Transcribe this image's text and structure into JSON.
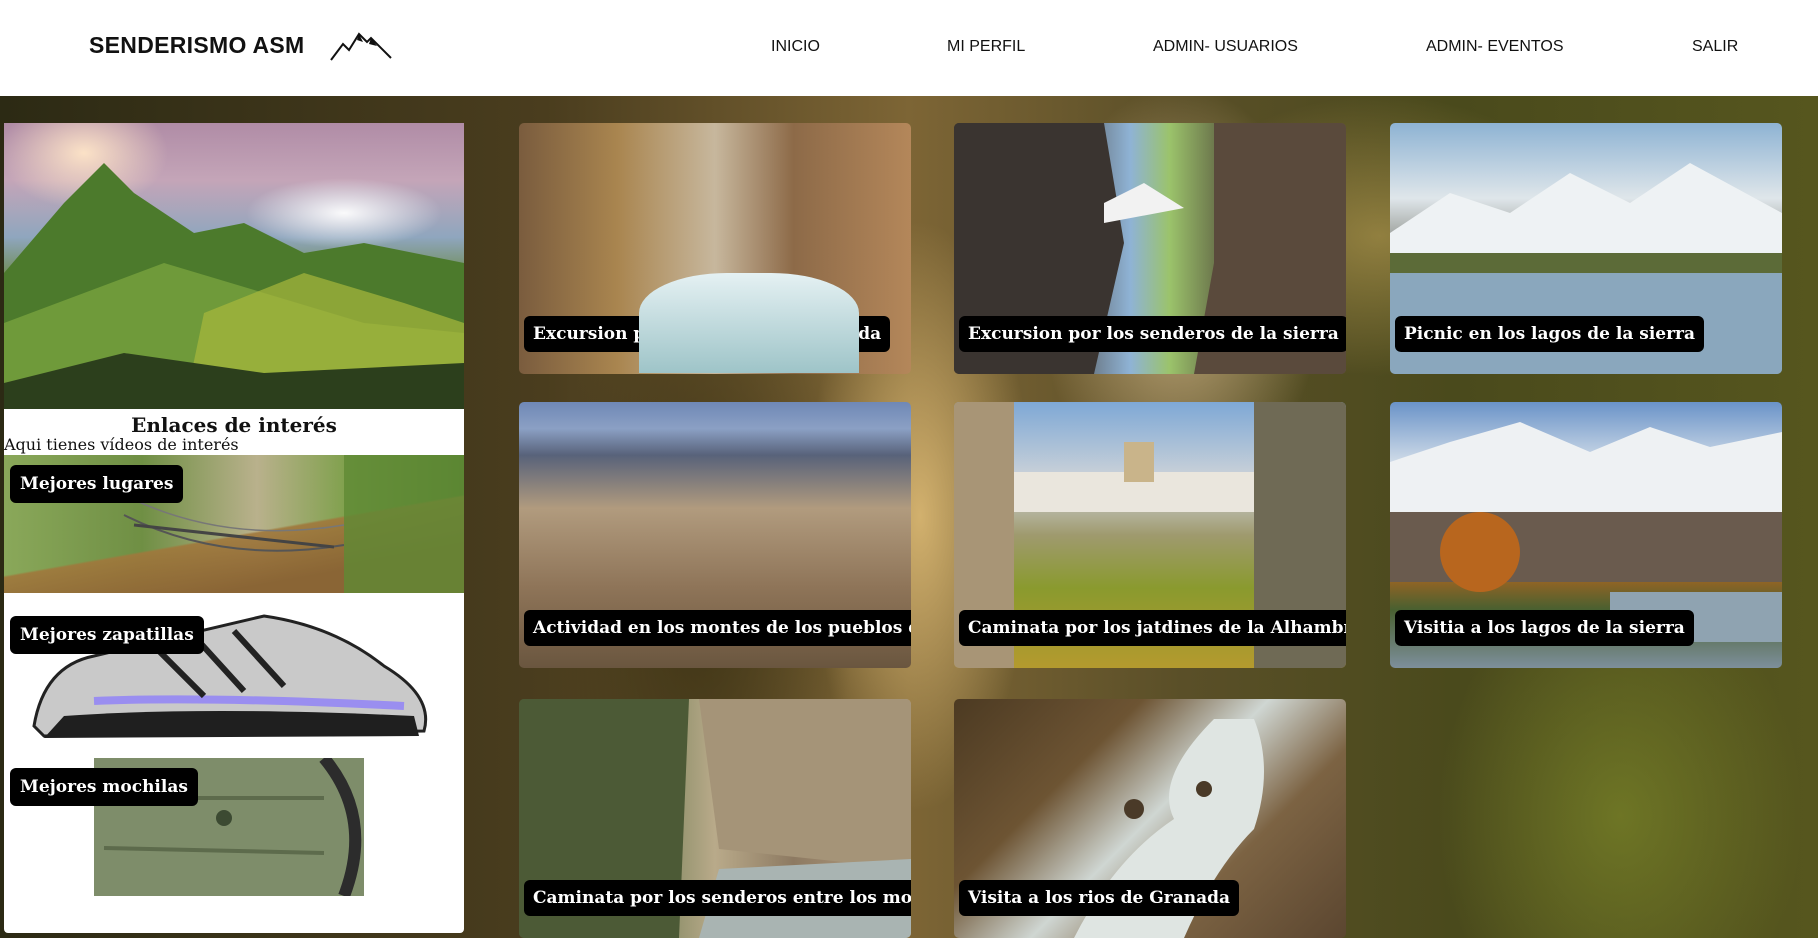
{
  "header": {
    "brand": "SENDERISMO ASM",
    "nav": [
      "INICIO",
      "MI PERFIL",
      "ADMIN- USUARIOS",
      "ADMIN- EVENTOS",
      "SALIR"
    ]
  },
  "sidebar": {
    "title": "Enlaces de interés",
    "subtitle": "Aqui tienes vídeos de interés",
    "links": [
      {
        "label": "Mejores lugares"
      },
      {
        "label": "Mejores zapatillas"
      },
      {
        "label": "Mejores mochilas"
      }
    ]
  },
  "events": [
    {
      "label": "Excursion por las cuevas de granada"
    },
    {
      "label": "Excursion por los senderos de la sierra"
    },
    {
      "label": "Picnic en los lagos de la sierra"
    },
    {
      "label": "Actividad en los montes de los pueblos de la sie"
    },
    {
      "label": "Caminata por los jatdines de la Alhambra"
    },
    {
      "label": "Visitia a los lagos de la sierra"
    },
    {
      "label": "Caminata por los senderos entre los montes"
    },
    {
      "label": "Visita a los rios de Granada"
    }
  ],
  "colors": {
    "header_bg": "#ffffff",
    "label_bg": "#000000",
    "label_text": "#ffffff"
  }
}
